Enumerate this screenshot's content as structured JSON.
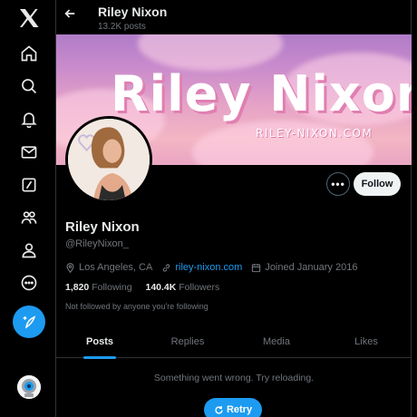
{
  "nav": {
    "items": [
      "x-logo",
      "home",
      "explore",
      "notifications",
      "messages",
      "grok",
      "communities",
      "profile",
      "more"
    ]
  },
  "header": {
    "name": "Riley Nixon",
    "posts_count": "13.2K posts"
  },
  "banner": {
    "title": "Riley Nixon",
    "url": "RILEY-NIXON.COM"
  },
  "profile": {
    "name": "Riley Nixon",
    "handle": "@RileyNixon_",
    "location": "Los Angeles, CA",
    "website": "riley-nixon.com",
    "joined": "Joined January 2016",
    "following_count": "1,820",
    "following_label": "Following",
    "followers_count": "140.4K",
    "followers_label": "Followers",
    "mutuals_note": "Not followed by anyone you're following"
  },
  "actions": {
    "more_label": "•••",
    "follow_label": "Follow"
  },
  "tabs": [
    {
      "label": "Posts",
      "active": true
    },
    {
      "label": "Replies",
      "active": false
    },
    {
      "label": "Media",
      "active": false
    },
    {
      "label": "Likes",
      "active": false
    }
  ],
  "feed": {
    "error_message": "Something went wrong. Try reloading.",
    "retry_label": "Retry"
  },
  "colors": {
    "accent": "#1d9bf0",
    "background": "#000000",
    "text_primary": "#e7e9ea",
    "text_secondary": "#71767b"
  }
}
